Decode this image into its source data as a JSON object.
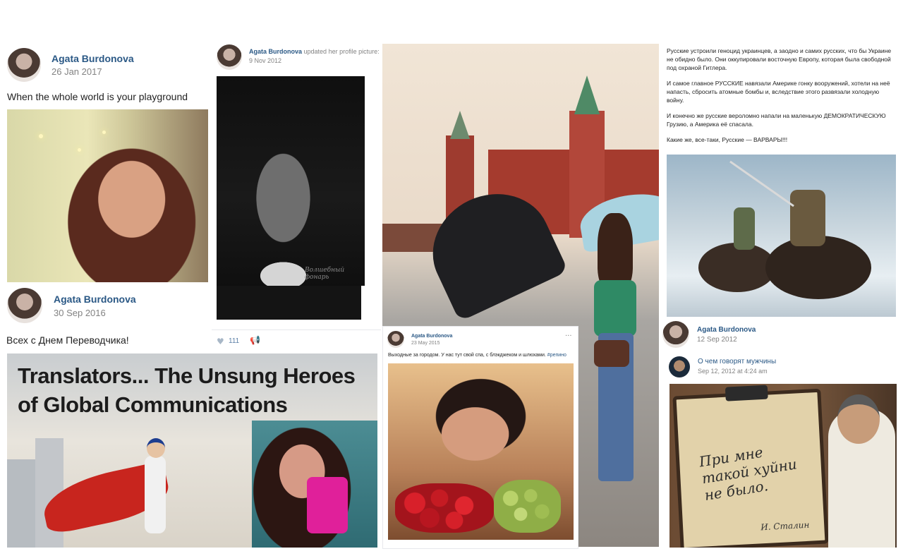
{
  "post1": {
    "author": "Agata Burdonova",
    "date": "26 Jan 2017",
    "text": "When the whole world is your playground"
  },
  "post2": {
    "author": "Agata Burdonova",
    "action": "updated her profile picture:",
    "date": "9 Nov 2012",
    "likes": "111",
    "watermark": "Волшебный фонарь"
  },
  "post3": {
    "author": "Agata Burdonova",
    "date": "30 Sep 2016",
    "text": "Всех с Днем Переводчика!",
    "banner_line1": "Translators... The Unsung Heroes",
    "banner_line2": "of Global Communications"
  },
  "post4": {
    "author": "Agata Burdonova",
    "date": "23 May 2015",
    "text": "Выходные за городом. У нас тут свой спа, с блэкджеком и шлюхами.",
    "hashtag": "#репино",
    "more": "···"
  },
  "post5": {
    "p1": "Русские устроили геноцид украинцев, а заодно и самих русских, что бы Украине не обидно было. Они оккупировали восточную Европу, которая была свободной под охраной Гитлера.",
    "p2": "И самое главное РУССКИЕ навязали Америке гонку вооружений, хотели на неё напасть, сбросить атомные бомбы и, вследствие этого развязали холодную войну.",
    "p3": "И конечно же русские вероломно напали на маленькую ДЕМОКРАТИЧЕСКУЮ Грузию, а Америка её спасала.",
    "p4": "Какие же, все-таки, Русские — ВАРВАРЫ!!!"
  },
  "post6": {
    "author": "Agata Burdonova",
    "date": "12 Sep 2012",
    "repost_author": "О чем говорят мужчины",
    "repost_date": "Sep 12, 2012 at 4:24 am",
    "quote": "При мне такой хуйни не было.",
    "signature": "И. Сталин"
  },
  "colors": {
    "link": "#2a5885",
    "muted": "#828282",
    "accent_pink": "#e0209a"
  }
}
